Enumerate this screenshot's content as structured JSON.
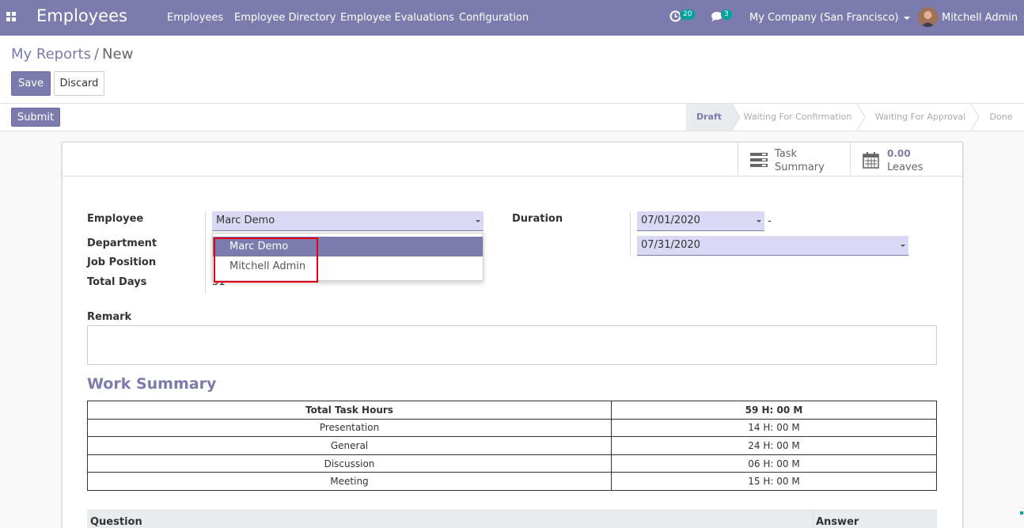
{
  "navbar": {
    "app_title": "Employees",
    "menu": [
      "Employees",
      "Employee Directory",
      "Employee Evaluations",
      "Configuration"
    ],
    "activity_count": "20",
    "message_count": "3",
    "company": "My Company (San Francisco)",
    "user": "Mitchell Admin",
    "icons": {
      "apps": "apps-grid-icon",
      "activity": "clock-icon",
      "messages": "chat-icon"
    }
  },
  "breadcrumb": {
    "parent": "My Reports",
    "separator": "/",
    "current": "New"
  },
  "buttons": {
    "save": "Save",
    "discard": "Discard",
    "submit": "Submit"
  },
  "statusbar": {
    "stages": [
      "Draft",
      "Waiting For Confirmation",
      "Waiting For Approval",
      "Done"
    ],
    "active": "Draft"
  },
  "stat_buttons": {
    "task_summary": {
      "line1": "Task",
      "line2": "Summary",
      "icon": "list-icon"
    },
    "leaves": {
      "value": "0.00",
      "label": "Leaves",
      "icon": "calendar-icon"
    }
  },
  "form": {
    "employee_label": "Employee",
    "employee_value": "Marc Demo",
    "department_label": "Department",
    "job_position_label": "Job Position",
    "total_days_label": "Total Days",
    "total_days_value": "31",
    "duration_label": "Duration",
    "date_from": "07/01/2020",
    "date_to": "07/31/2020",
    "range_separator": "-",
    "remark_label": "Remark",
    "remark_value": ""
  },
  "employee_dropdown": {
    "options": [
      "Marc Demo",
      "Mitchell Admin"
    ],
    "highlighted": "Marc Demo"
  },
  "work_summary": {
    "title": "Work Summary",
    "rows": [
      {
        "name": "Total Task Hours",
        "hours": "59 H: 00 M"
      },
      {
        "name": "Presentation",
        "hours": "14 H: 00 M"
      },
      {
        "name": "General",
        "hours": "24 H: 00 M"
      },
      {
        "name": "Discussion",
        "hours": "06 H: 00 M"
      },
      {
        "name": "Meeting",
        "hours": "15 H: 00 M"
      }
    ]
  },
  "questions_table": {
    "columns": [
      "Question",
      "Answer"
    ]
  },
  "colors": {
    "brand": "#7c7bad",
    "badge": "#00a09d",
    "input_bg": "#d9d8f5",
    "highlight_box": "#e4021b"
  }
}
